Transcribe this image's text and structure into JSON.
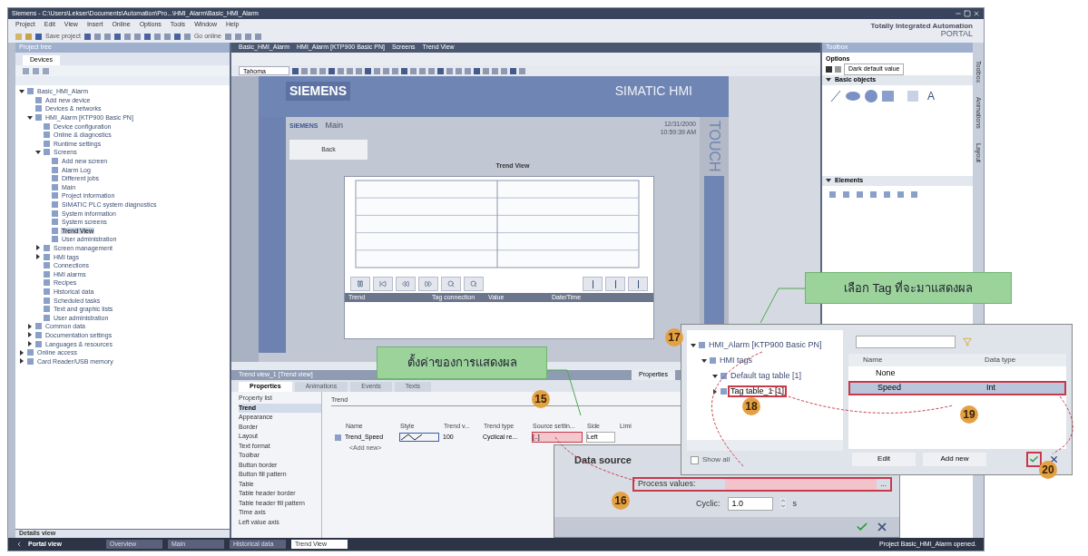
{
  "window": {
    "title": "Siemens - C:\\Users\\Lekser\\Documents\\Automation\\Pro...\\HMI_Alarm\\Basic_HMI_Alarm",
    "brand_line1": "Totally Integrated Automation",
    "brand_line2": "PORTAL"
  },
  "menu": [
    "Project",
    "Edit",
    "View",
    "Insert",
    "Online",
    "Options",
    "Tools",
    "Window",
    "Help"
  ],
  "toolbar": {
    "save_label": "Save project",
    "online_label": "Go online"
  },
  "project_tree": {
    "title": "Project tree",
    "tab": "Devices",
    "details": "Details view",
    "items": [
      {
        "label": "Basic_HMI_Alarm",
        "expanded": true,
        "selected": false,
        "children": [
          {
            "label": "Add new device",
            "selected": false
          },
          {
            "label": "Devices & networks",
            "selected": false
          },
          {
            "label": "HMI_Alarm [KTP900 Basic PN]",
            "expanded": true,
            "selected": false,
            "children": [
              {
                "label": "Device configuration",
                "selected": false
              },
              {
                "label": "Online & diagnostics",
                "selected": false
              },
              {
                "label": "Runtime settings",
                "selected": false
              },
              {
                "label": "Screens",
                "expanded": true,
                "selected": false,
                "children": [
                  {
                    "label": "Add new screen",
                    "selected": false
                  },
                  {
                    "label": "Alarm Log",
                    "selected": false
                  },
                  {
                    "label": "Different jobs",
                    "selected": false
                  },
                  {
                    "label": "Main",
                    "selected": false
                  },
                  {
                    "label": "Project information",
                    "selected": false
                  },
                  {
                    "label": "SIMATIC PLC system diagnostics",
                    "selected": false
                  },
                  {
                    "label": "System information",
                    "selected": false
                  },
                  {
                    "label": "System screens",
                    "selected": false
                  },
                  {
                    "label": "Trend View",
                    "selected": true
                  },
                  {
                    "label": "User administration",
                    "selected": false
                  }
                ]
              },
              {
                "label": "Screen management",
                "expanded": false,
                "selected": false
              },
              {
                "label": "HMI tags",
                "expanded": false,
                "selected": false
              },
              {
                "label": "Connections",
                "selected": false
              },
              {
                "label": "HMI alarms",
                "selected": false
              },
              {
                "label": "Recipes",
                "selected": false
              },
              {
                "label": "Historical data",
                "selected": false
              },
              {
                "label": "Scheduled tasks",
                "selected": false
              },
              {
                "label": "Text and graphic lists",
                "selected": false
              },
              {
                "label": "User administration",
                "selected": false
              }
            ]
          },
          {
            "label": "Common data",
            "expanded": false,
            "selected": false
          },
          {
            "label": "Documentation settings",
            "expanded": false,
            "selected": false
          },
          {
            "label": "Languages & resources",
            "expanded": false,
            "selected": false
          }
        ]
      },
      {
        "label": "Online access",
        "expanded": false,
        "selected": false
      },
      {
        "label": "Card Reader/USB memory",
        "expanded": false,
        "selected": false
      }
    ]
  },
  "editor": {
    "breadcrumb": [
      "Basic_HMI_Alarm",
      "HMI_Alarm [KTP900 Basic PN]",
      "Screens",
      "Trend View"
    ],
    "font": "Tahoma",
    "hmi": {
      "brand": "SIEMENS",
      "product": "SIMATIC HMI",
      "logo": "SIEMENS",
      "screen_name": "Main",
      "date": "12/31/2000",
      "time": "10:59:39 AM",
      "back": "Back",
      "title": "Trend View",
      "touch": "TOUCH",
      "table_columns": [
        "Trend",
        "Tag connection",
        "Value",
        "Date/Time"
      ]
    }
  },
  "inspector": {
    "title": "Trend view_1 [Trend view]",
    "properties_button": "Properties",
    "tabs": [
      {
        "label": "Properties",
        "selected": true
      },
      {
        "label": "Animations",
        "selected": false
      },
      {
        "label": "Events",
        "selected": false
      },
      {
        "label": "Texts",
        "selected": false
      }
    ],
    "property_list_label": "Property list",
    "property_list": [
      {
        "label": "Trend",
        "selected": true
      },
      {
        "label": "Appearance",
        "selected": false
      },
      {
        "label": "Border",
        "selected": false
      },
      {
        "label": "Layout",
        "selected": false
      },
      {
        "label": "Text format",
        "selected": false
      },
      {
        "label": "Toolbar",
        "selected": false
      },
      {
        "label": "Button border",
        "selected": false
      },
      {
        "label": "Button fill pattern",
        "selected": false
      },
      {
        "label": "Table",
        "selected": false
      },
      {
        "label": "Table header border",
        "selected": false
      },
      {
        "label": "Table header fill pattern",
        "selected": false
      },
      {
        "label": "Time axis",
        "selected": false
      },
      {
        "label": "Left value axis",
        "selected": false
      }
    ],
    "section": "Trend",
    "columns": [
      "Name",
      "Style",
      "Trend v...",
      "Trend type",
      "Source settin...",
      "Side",
      "Limi"
    ],
    "row": {
      "name": "Trend_Speed",
      "trend_values": "100",
      "trend_type": "Cyclical re...",
      "source": "[..]",
      "side": "Left"
    },
    "add_new": "<Add new>"
  },
  "toolbox": {
    "title": "Toolbox",
    "options": "Options",
    "dropdown": "Dark default value",
    "basic_objects": "Basic objects",
    "text_tool": "A",
    "elements": "Elements",
    "side_tabs": [
      "Toolbox",
      "Animations",
      "Layout"
    ]
  },
  "taskbar": {
    "portal": "Portal view",
    "tabs": [
      {
        "label": "Overview",
        "selected": false
      },
      {
        "label": "Main",
        "selected": false
      },
      {
        "label": "Historical data",
        "selected": false
      },
      {
        "label": "Trend View",
        "selected": true
      }
    ],
    "status": "Project Basic_HMI_Alarm opened."
  },
  "data_source": {
    "title": "Data source",
    "process_label": "Process values:",
    "process_button": "...",
    "cyclic_label": "Cyclic:",
    "cyclic_value": "1.0",
    "unit": "s"
  },
  "tag_dialog": {
    "tree": [
      {
        "label": "HMI_Alarm [KTP900 Basic PN]",
        "expanded": true,
        "selected": false,
        "children": [
          {
            "label": "HMI tags",
            "expanded": true,
            "selected": false,
            "children": [
              {
                "label": "Default tag table [1]",
                "expanded": true,
                "selected": false
              },
              {
                "label": "Tag table_1 [1]",
                "expanded": false,
                "selected": true
              }
            ]
          }
        ]
      }
    ],
    "columns": [
      "Name",
      "Data type"
    ],
    "rows": [
      {
        "name": "None",
        "selected": false
      },
      {
        "name": "Speed",
        "type": "Int",
        "selected": true
      }
    ],
    "show_all": {
      "label": "Show all",
      "checked": false
    },
    "edit": "Edit",
    "add_new": "Add new"
  },
  "callouts": [
    "เลือก Tag ที่จะมาแสดงผล",
    "ตั้งค่าของการแสดงผล"
  ],
  "steps": [
    "15",
    "16",
    "17",
    "18",
    "19",
    "20"
  ]
}
